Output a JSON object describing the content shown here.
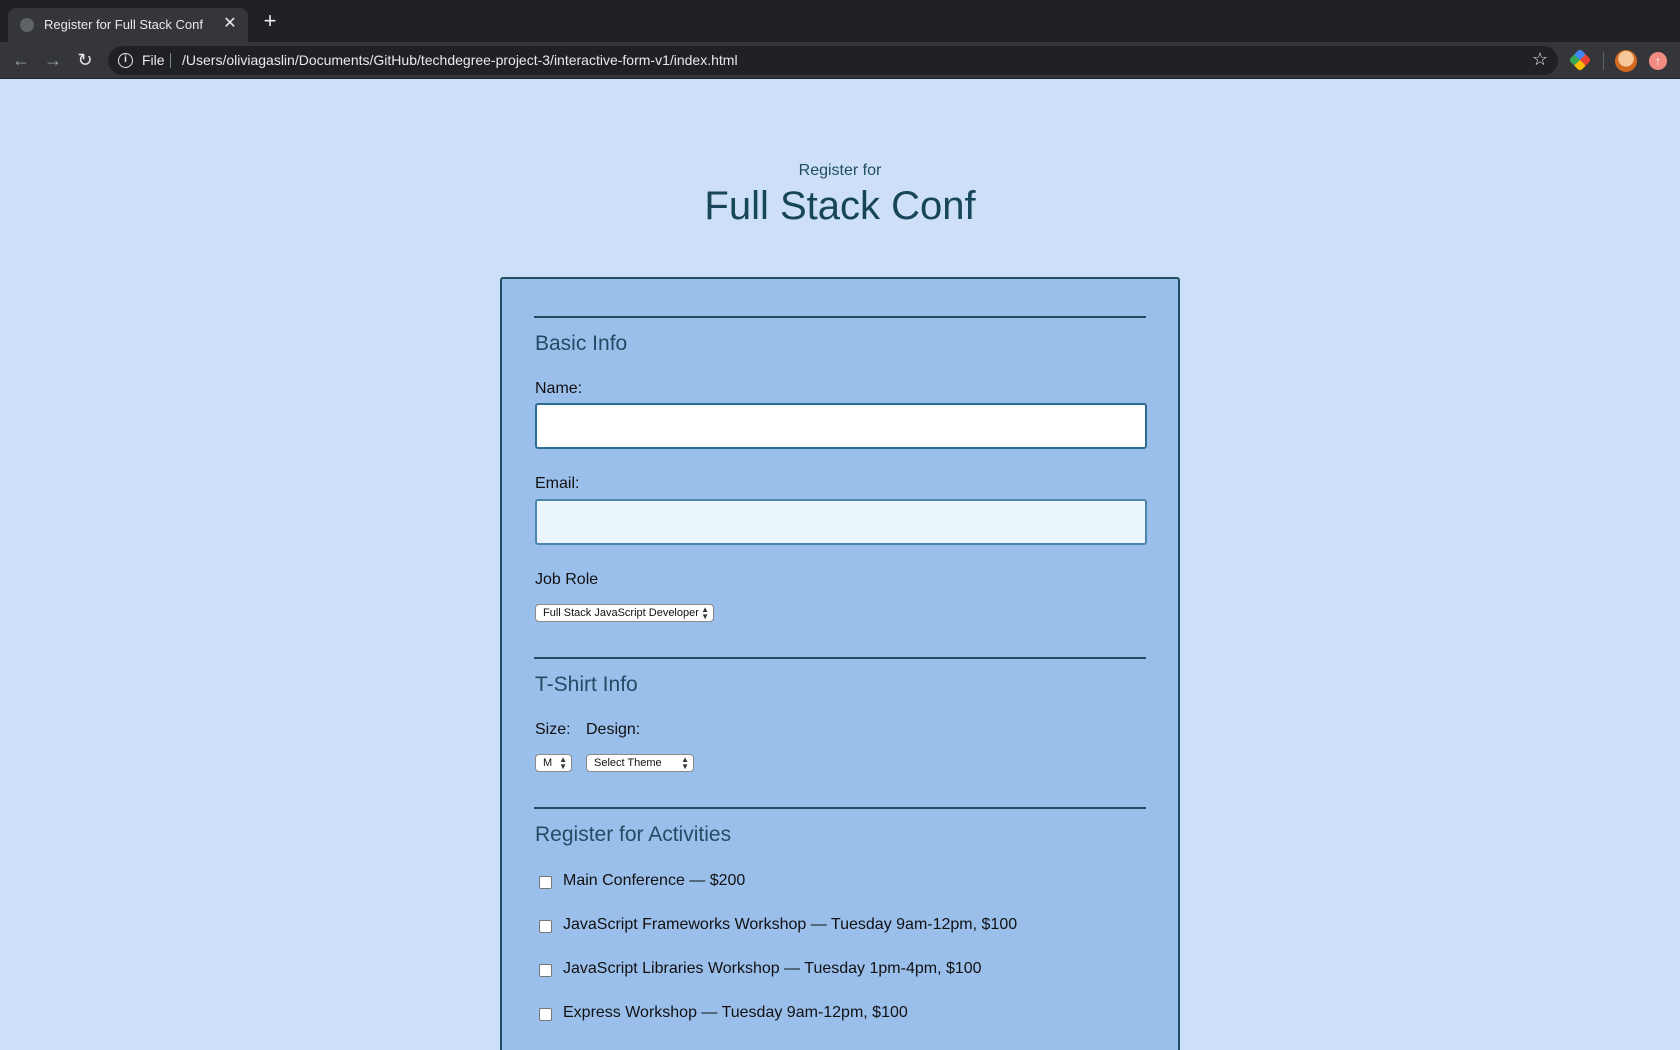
{
  "browser": {
    "tab_title": "Register for Full Stack Conf",
    "new_tab_symbol": "+",
    "omnibox": {
      "scheme_label": "File",
      "url": "/Users/oliviagaslin/Documents/GitHub/techdegree-project-3/interactive-form-v1/index.html"
    },
    "icons": [
      "back-arrow-icon",
      "forward-arrow-icon",
      "reload-icon",
      "info-icon",
      "star-icon",
      "extension-icon",
      "profile-avatar",
      "update-icon"
    ]
  },
  "page": {
    "subtitle": "Register for",
    "title": "Full Stack Conf",
    "colors": {
      "background": "#cde0f7",
      "form_background": "#9bbfeb",
      "accent": "#1f4e64"
    }
  },
  "form": {
    "basic_info": {
      "legend": "Basic Info",
      "name_label": "Name:",
      "name_value": "",
      "email_label": "Email:",
      "email_value": "",
      "job_role_label": "Job Role",
      "job_role_selected": "Full Stack JavaScript Developer"
    },
    "tshirt": {
      "legend": "T-Shirt Info",
      "size_label": "Size:",
      "size_selected": "M",
      "design_label": "Design:",
      "design_selected": "Select Theme"
    },
    "activities": {
      "legend": "Register for Activities",
      "items": [
        {
          "label": "Main Conference — $200",
          "checked": false
        },
        {
          "label": "JavaScript Frameworks Workshop — Tuesday 9am-12pm, $100",
          "checked": false
        },
        {
          "label": "JavaScript Libraries Workshop — Tuesday 1pm-4pm, $100",
          "checked": false
        },
        {
          "label": "Express Workshop — Tuesday 9am-12pm, $100",
          "checked": false
        }
      ]
    }
  }
}
